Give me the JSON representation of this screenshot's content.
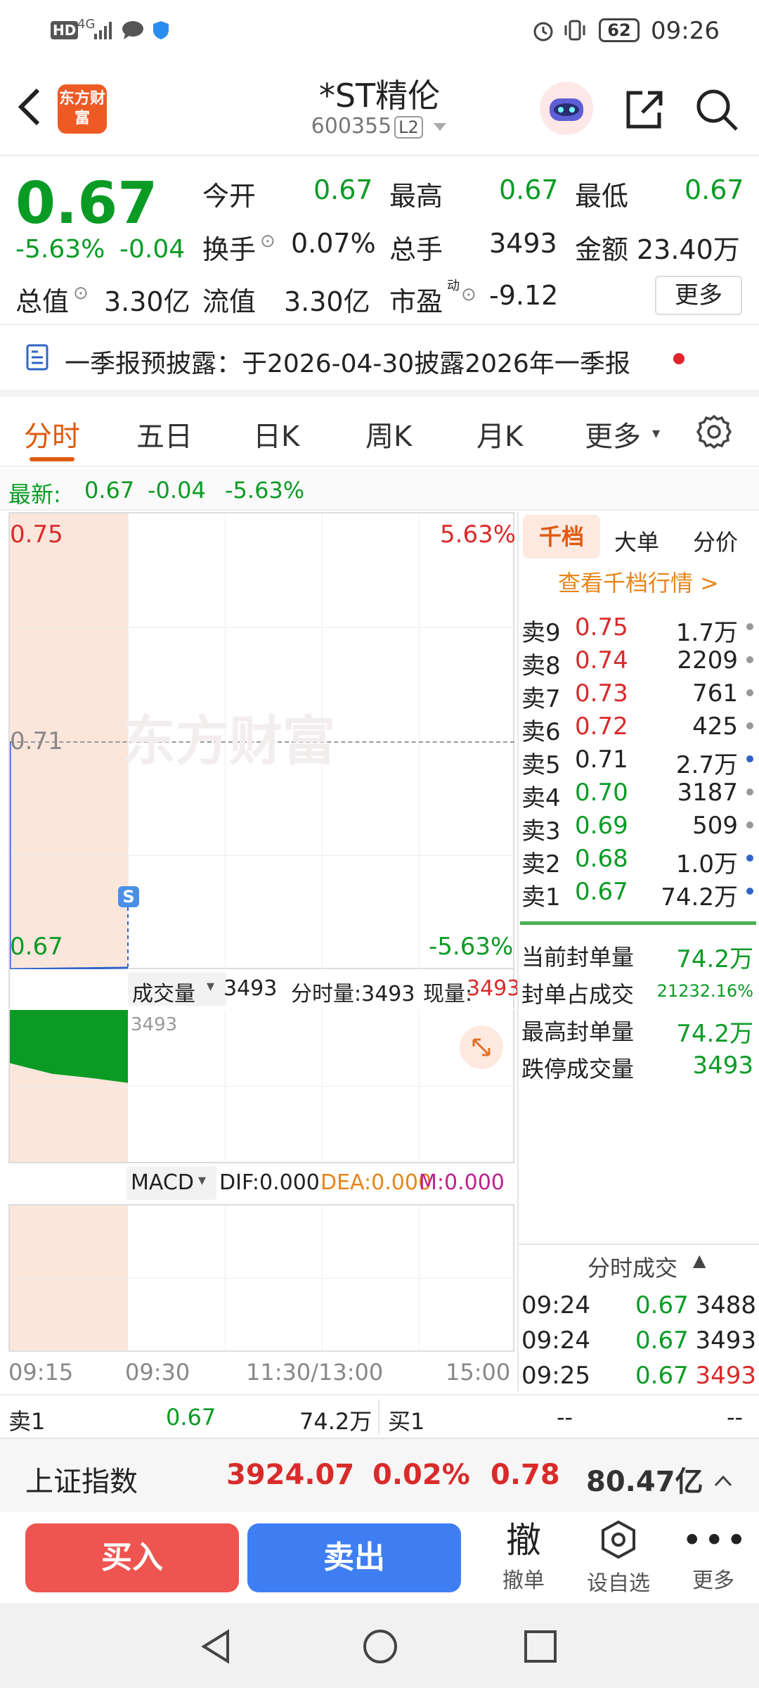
{
  "status_bar": {
    "left_icons": [
      "HD",
      "4G"
    ],
    "battery": "62",
    "time": "09:26"
  },
  "header": {
    "logo_text": "东方财富",
    "title": "*ST精伦",
    "code": "600355",
    "level_badge": "L2"
  },
  "quote": {
    "price": "0.67",
    "change_pct": "-5.63%",
    "change": "-0.04",
    "open_label": "今开",
    "open": "0.67",
    "high_label": "最高",
    "high": "0.67",
    "low_label": "最低",
    "low": "0.67",
    "turnover_label": "换手",
    "turnover": "0.07%",
    "volume_label": "总手",
    "volume": "3493",
    "amount_label": "金额",
    "amount": "23.40万",
    "mktcap_label": "总值",
    "mktcap": "3.30亿",
    "float_label": "流值",
    "float": "3.30亿",
    "pe_label": "市盈",
    "pe_sup": "动",
    "pe": "-9.12",
    "more_label": "更多"
  },
  "notice": {
    "text": "一季报预披露：于2026-04-30披露2026年一季报"
  },
  "tabs": [
    "分时",
    "五日",
    "日K",
    "周K",
    "月K",
    "更多"
  ],
  "latest": {
    "label": "最新:",
    "price": "0.67",
    "change": "-0.04",
    "pct": "-5.63%"
  },
  "chart": {
    "y_top": "0.75",
    "y_mid": "0.71",
    "y_bottom": "0.67",
    "pct_top": "5.63%",
    "pct_bottom": "-5.63%",
    "watermark": "东方财富",
    "marker": "S",
    "vol_selector": "成交量",
    "vol_total": "3493",
    "vol_period_label": "分时量:3493",
    "vol_now_label": "现量:",
    "vol_now": "3493",
    "vol_axis": "3493",
    "macd_selector": "MACD",
    "dif": "DIF:0.000",
    "dea": "DEA:0.000",
    "m": "M:0.000",
    "times": [
      "09:15",
      "09:30",
      "11:30/13:00",
      "15:00"
    ]
  },
  "chart_data": {
    "type": "line",
    "x": [
      "09:15",
      "09:25"
    ],
    "series": [
      {
        "values": [
          0.71,
          0.67
        ]
      }
    ],
    "ylim": [
      0.67,
      0.75
    ],
    "volume": [
      3493
    ]
  },
  "orderbook": {
    "tabs": [
      "千档",
      "大单",
      "分价"
    ],
    "view_link": "查看千档行情 >",
    "asks": [
      {
        "label": "卖9",
        "price": "0.75",
        "vol": "1.7万",
        "pc": "r",
        "dot": "#999"
      },
      {
        "label": "卖8",
        "price": "0.74",
        "vol": "2209",
        "pc": "r",
        "dot": "#999"
      },
      {
        "label": "卖7",
        "price": "0.73",
        "vol": "761",
        "pc": "r",
        "dot": "#999"
      },
      {
        "label": "卖6",
        "price": "0.72",
        "vol": "425",
        "pc": "r",
        "dot": "#999"
      },
      {
        "label": "卖5",
        "price": "0.71",
        "vol": "2.7万",
        "pc": "k",
        "dot": "#2f64c8"
      },
      {
        "label": "卖4",
        "price": "0.70",
        "vol": "3187",
        "pc": "g",
        "dot": "#999"
      },
      {
        "label": "卖3",
        "price": "0.69",
        "vol": "509",
        "pc": "g",
        "dot": "#999"
      },
      {
        "label": "卖2",
        "price": "0.68",
        "vol": "1.0万",
        "pc": "g",
        "dot": "#2f64c8"
      },
      {
        "label": "卖1",
        "price": "0.67",
        "vol": "74.2万",
        "pc": "g",
        "dot": "#2f64c8"
      }
    ],
    "stats": [
      {
        "label": "当前封单量",
        "value": "74.2万"
      },
      {
        "label": "封单占成交",
        "value": "21232.16%"
      },
      {
        "label": "最高封单量",
        "value": "74.2万"
      },
      {
        "label": "跌停成交量",
        "value": "3493"
      }
    ],
    "trades_title": "分时成交",
    "trades": [
      {
        "time": "09:24",
        "price": "0.67",
        "vol": "3488",
        "vc": "k"
      },
      {
        "time": "09:24",
        "price": "0.67",
        "vol": "3493",
        "vc": "k"
      },
      {
        "time": "09:25",
        "price": "0.67",
        "vol": "3493",
        "vc": "r"
      }
    ]
  },
  "bottom_quote": {
    "ask_label": "卖1",
    "ask_price": "0.67",
    "ask_vol": "74.2万",
    "bid_label": "买1",
    "bid_price": "--",
    "bid_vol": "--"
  },
  "index": {
    "name": "上证指数",
    "value": "3924.07",
    "pct": "0.02%",
    "change": "0.78",
    "amount": "80.47亿"
  },
  "actions": {
    "buy": "买入",
    "sell": "卖出",
    "cancel_glyph": "撤",
    "cancel": "撤单",
    "watch": "设自选",
    "more": "更多"
  }
}
